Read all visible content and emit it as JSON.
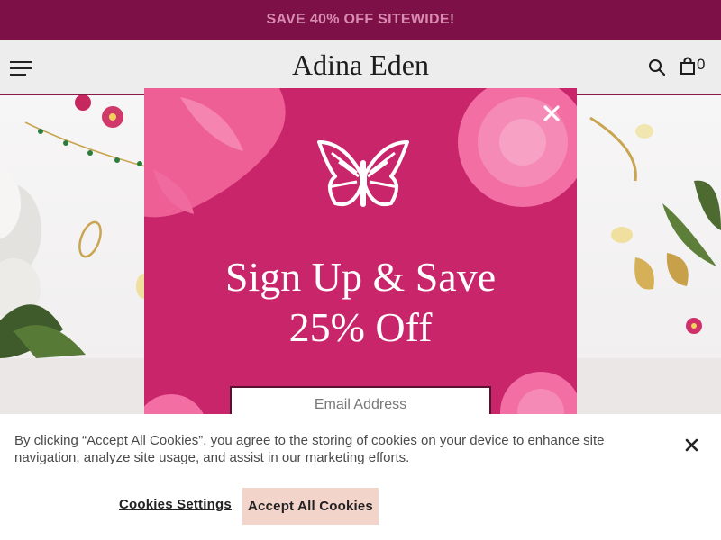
{
  "promo": {
    "text": "SAVE 40% OFF SITEWIDE!"
  },
  "header": {
    "brand": "Adina Eden",
    "cart_count": "0",
    "icons": {
      "menu": "hamburger-menu-icon",
      "search": "search-icon",
      "bag": "shopping-bag-icon"
    }
  },
  "modal": {
    "title_line1": "Sign Up & Save",
    "title_line2": "25% Off",
    "email_placeholder": "Email Address",
    "logo_icon": "butterfly-icon",
    "close_icon": "close-icon"
  },
  "cookie": {
    "text": "By clicking “Accept All Cookies”, you agree to the storing of cookies on your device to enhance site navigation, analyze site usage, and assist in our marketing efforts.",
    "settings_label": "Cookies Settings",
    "accept_label": "Accept All Cookies"
  },
  "colors": {
    "promo_bg": "#7d1147",
    "modal_bg": "#c9256b",
    "accept_bg": "#f3d4cb"
  }
}
